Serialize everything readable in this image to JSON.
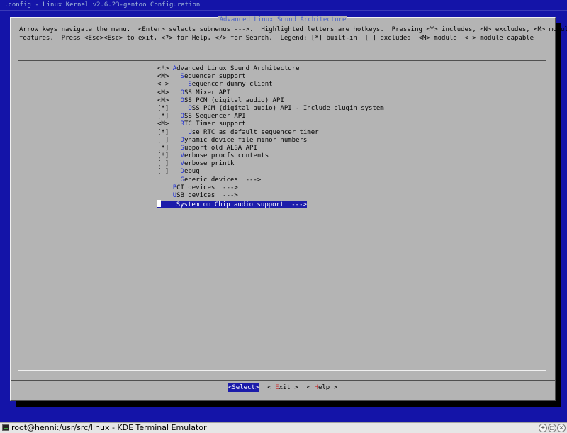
{
  "terminal": {
    "title": ".config - Linux Kernel v2.6.23-gentoo Configuration"
  },
  "dialog": {
    "title": "Advanced Linux Sound Architecture",
    "help_line1": "Arrow keys navigate the menu.  <Enter> selects submenus --->.  Highlighted letters are hotkeys.  Pressing <Y> includes, <N> excludes, <M> modularizes",
    "help_line2": "features.  Press <Esc><Esc> to exit, <?> for Help, </> for Search.  Legend: [*] built-in  [ ] excluded  <M> module  < > module capable"
  },
  "menu": {
    "items": [
      {
        "prefix": "<*> ",
        "indent": "",
        "hotkey": "A",
        "rest": "dvanced Linux Sound Architecture"
      },
      {
        "prefix": "<M>   ",
        "indent": "",
        "hotkey": "S",
        "rest": "equencer support"
      },
      {
        "prefix": "< >     ",
        "indent": "",
        "hotkey": "S",
        "rest": "equencer dummy client"
      },
      {
        "prefix": "<M>   ",
        "indent": "",
        "hotkey": "O",
        "rest": "SS Mixer API"
      },
      {
        "prefix": "<M>   ",
        "indent": "",
        "hotkey": "O",
        "rest": "SS PCM (digital audio) API"
      },
      {
        "prefix": "[*]     ",
        "indent": "",
        "hotkey": "O",
        "rest": "SS PCM (digital audio) API - Include plugin system"
      },
      {
        "prefix": "[*]   ",
        "indent": "",
        "hotkey": "O",
        "rest": "SS Sequencer API"
      },
      {
        "prefix": "<M>   ",
        "indent": "",
        "hotkey": "R",
        "rest": "TC Timer support"
      },
      {
        "prefix": "[*]     ",
        "indent": "",
        "hotkey": "U",
        "rest": "se RTC as default sequencer timer"
      },
      {
        "prefix": "[ ]   ",
        "indent": "",
        "hotkey": "D",
        "rest": "ynamic device file minor numbers"
      },
      {
        "prefix": "[*]   ",
        "indent": "",
        "hotkey": "S",
        "rest": "upport old ALSA API"
      },
      {
        "prefix": "[*]   ",
        "indent": "",
        "hotkey": "V",
        "rest": "erbose procfs contents"
      },
      {
        "prefix": "[ ]   ",
        "indent": "",
        "hotkey": "V",
        "rest": "erbose printk"
      },
      {
        "prefix": "[ ]   ",
        "indent": "",
        "hotkey": "D",
        "rest": "ebug"
      },
      {
        "prefix": "      ",
        "indent": "",
        "hotkey": "G",
        "rest": "eneric devices  --->"
      },
      {
        "prefix": "    ",
        "indent": "",
        "hotkey": "P",
        "rest": "CI devices  --->"
      },
      {
        "prefix": "    ",
        "indent": "",
        "hotkey": "U",
        "rest": "SB devices  --->"
      },
      {
        "prefix": "    ",
        "indent": "",
        "hotkey": "S",
        "rest": "ystem on Chip audio support  --->"
      }
    ]
  },
  "buttons": {
    "select_open": "<",
    "select_label": "Select",
    "select_close": ">",
    "exit_open": "< ",
    "exit_hotkey": "E",
    "exit_rest": "xit",
    "exit_close": " >",
    "help_open": "< ",
    "help_hotkey": "H",
    "help_rest": "elp",
    "help_close": " >"
  },
  "taskbar": {
    "title": "root@henni:/usr/src/linux - KDE Terminal Emulator",
    "ctl_minimize": "+",
    "ctl_maximize": "□",
    "ctl_close": "×"
  }
}
